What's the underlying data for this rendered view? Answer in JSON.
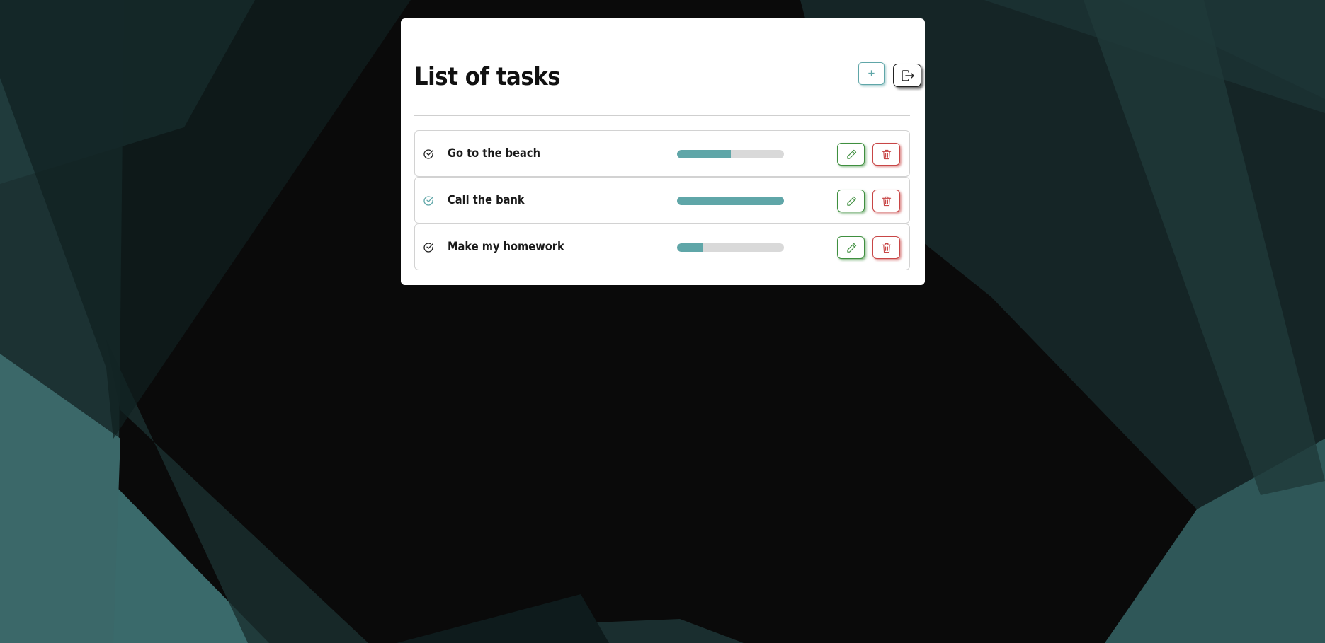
{
  "page": {
    "title": "List of tasks"
  },
  "header": {
    "add_button": {
      "icon": "plus-icon",
      "glyph": "+"
    },
    "logout_button": {
      "icon": "logout-icon"
    }
  },
  "tasks": [
    {
      "name": "Go to the beach",
      "progress": 0.5,
      "check_color": "#222222"
    },
    {
      "name": "Call the bank",
      "progress": 1.0,
      "check_color": "#5fa6a8"
    },
    {
      "name": "Make my homework",
      "progress": 0.24,
      "check_color": "#222222"
    }
  ],
  "colors": {
    "accent": "#5fa6a8",
    "edit": "#3f8f3f",
    "delete": "#c84646",
    "progress_track": "#d9d9d9"
  },
  "icons": {
    "complete": "check-circle-icon",
    "edit": "pencil-icon",
    "delete": "trash-icon"
  }
}
